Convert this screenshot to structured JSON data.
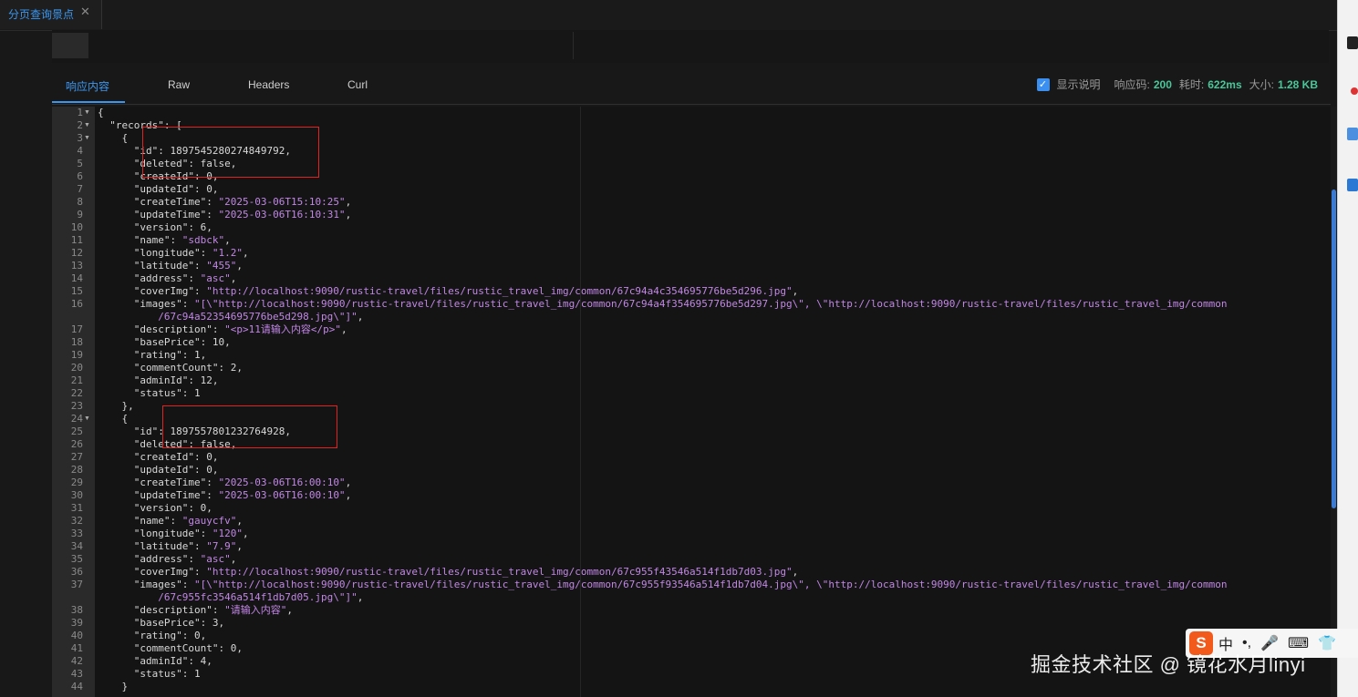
{
  "tab": {
    "title": "分页查询景点",
    "close": "✕"
  },
  "response_tabs": [
    "响应内容",
    "Raw",
    "Headers",
    "Curl"
  ],
  "meta": {
    "show_desc": "显示说明",
    "status_label": "响应码:",
    "status_value": "200",
    "time_label": "耗时:",
    "time_value": "622ms",
    "size_label": "大小:",
    "size_value": "1.28 KB"
  },
  "code_lines": [
    [
      [
        "p",
        "{"
      ]
    ],
    [
      [
        "p",
        "  "
      ],
      [
        "k",
        "\"records\""
      ],
      [
        "p",
        ": ["
      ]
    ],
    [
      [
        "p",
        "    {"
      ]
    ],
    [
      [
        "p",
        "      "
      ],
      [
        "k",
        "\"id\""
      ],
      [
        "p",
        ": 1897545280274849792,"
      ]
    ],
    [
      [
        "p",
        "      "
      ],
      [
        "k",
        "\"deleted\""
      ],
      [
        "p",
        ": false,"
      ]
    ],
    [
      [
        "p",
        "      "
      ],
      [
        "k",
        "\"createId\""
      ],
      [
        "p",
        ": 0,"
      ]
    ],
    [
      [
        "p",
        "      "
      ],
      [
        "k",
        "\"updateId\""
      ],
      [
        "p",
        ": 0,"
      ]
    ],
    [
      [
        "p",
        "      "
      ],
      [
        "k",
        "\"createTime\""
      ],
      [
        "p",
        ": "
      ],
      [
        "s",
        "\"2025-03-06T15:10:25\""
      ],
      [
        "p",
        ","
      ]
    ],
    [
      [
        "p",
        "      "
      ],
      [
        "k",
        "\"updateTime\""
      ],
      [
        "p",
        ": "
      ],
      [
        "s",
        "\"2025-03-06T16:10:31\""
      ],
      [
        "p",
        ","
      ]
    ],
    [
      [
        "p",
        "      "
      ],
      [
        "k",
        "\"version\""
      ],
      [
        "p",
        ": 6,"
      ]
    ],
    [
      [
        "p",
        "      "
      ],
      [
        "k",
        "\"name\""
      ],
      [
        "p",
        ": "
      ],
      [
        "s",
        "\"sdbck\""
      ],
      [
        "p",
        ","
      ]
    ],
    [
      [
        "p",
        "      "
      ],
      [
        "k",
        "\"longitude\""
      ],
      [
        "p",
        ": "
      ],
      [
        "s",
        "\"1.2\""
      ],
      [
        "p",
        ","
      ]
    ],
    [
      [
        "p",
        "      "
      ],
      [
        "k",
        "\"latitude\""
      ],
      [
        "p",
        ": "
      ],
      [
        "s",
        "\"455\""
      ],
      [
        "p",
        ","
      ]
    ],
    [
      [
        "p",
        "      "
      ],
      [
        "k",
        "\"address\""
      ],
      [
        "p",
        ": "
      ],
      [
        "s",
        "\"asc\""
      ],
      [
        "p",
        ","
      ]
    ],
    [
      [
        "p",
        "      "
      ],
      [
        "k",
        "\"coverImg\""
      ],
      [
        "p",
        ": "
      ],
      [
        "s",
        "\"http://localhost:9090/rustic-travel/files/rustic_travel_img/common/67c94a4c354695776be5d296.jpg\""
      ],
      [
        "p",
        ","
      ]
    ],
    [
      [
        "p",
        "      "
      ],
      [
        "k",
        "\"images\""
      ],
      [
        "p",
        ": "
      ],
      [
        "s",
        "\"[\\\"http://localhost:9090/rustic-travel/files/rustic_travel_img/common/67c94a4f354695776be5d297.jpg\\\", \\\"http://localhost:9090/rustic-travel/files/rustic_travel_img/common"
      ]
    ],
    [
      [
        "s",
        "          /67c94a52354695776be5d298.jpg\\\"]\""
      ],
      [
        "p",
        ","
      ]
    ],
    [
      [
        "p",
        "      "
      ],
      [
        "k",
        "\"description\""
      ],
      [
        "p",
        ": "
      ],
      [
        "s",
        "\"<p>11请输入内容</p>\""
      ],
      [
        "p",
        ","
      ]
    ],
    [
      [
        "p",
        "      "
      ],
      [
        "k",
        "\"basePrice\""
      ],
      [
        "p",
        ": 10,"
      ]
    ],
    [
      [
        "p",
        "      "
      ],
      [
        "k",
        "\"rating\""
      ],
      [
        "p",
        ": 1,"
      ]
    ],
    [
      [
        "p",
        "      "
      ],
      [
        "k",
        "\"commentCount\""
      ],
      [
        "p",
        ": 2,"
      ]
    ],
    [
      [
        "p",
        "      "
      ],
      [
        "k",
        "\"adminId\""
      ],
      [
        "p",
        ": 12,"
      ]
    ],
    [
      [
        "p",
        "      "
      ],
      [
        "k",
        "\"status\""
      ],
      [
        "p",
        ": 1"
      ]
    ],
    [
      [
        "p",
        "    },"
      ]
    ],
    [
      [
        "p",
        "    {"
      ]
    ],
    [
      [
        "p",
        "      "
      ],
      [
        "k",
        "\"id\""
      ],
      [
        "p",
        ": 1897557801232764928,"
      ]
    ],
    [
      [
        "p",
        "      "
      ],
      [
        "k",
        "\"deleted\""
      ],
      [
        "p",
        ": false,"
      ]
    ],
    [
      [
        "p",
        "      "
      ],
      [
        "k",
        "\"createId\""
      ],
      [
        "p",
        ": 0,"
      ]
    ],
    [
      [
        "p",
        "      "
      ],
      [
        "k",
        "\"updateId\""
      ],
      [
        "p",
        ": 0,"
      ]
    ],
    [
      [
        "p",
        "      "
      ],
      [
        "k",
        "\"createTime\""
      ],
      [
        "p",
        ": "
      ],
      [
        "s",
        "\"2025-03-06T16:00:10\""
      ],
      [
        "p",
        ","
      ]
    ],
    [
      [
        "p",
        "      "
      ],
      [
        "k",
        "\"updateTime\""
      ],
      [
        "p",
        ": "
      ],
      [
        "s",
        "\"2025-03-06T16:00:10\""
      ],
      [
        "p",
        ","
      ]
    ],
    [
      [
        "p",
        "      "
      ],
      [
        "k",
        "\"version\""
      ],
      [
        "p",
        ": 0,"
      ]
    ],
    [
      [
        "p",
        "      "
      ],
      [
        "k",
        "\"name\""
      ],
      [
        "p",
        ": "
      ],
      [
        "s",
        "\"gauycfv\""
      ],
      [
        "p",
        ","
      ]
    ],
    [
      [
        "p",
        "      "
      ],
      [
        "k",
        "\"longitude\""
      ],
      [
        "p",
        ": "
      ],
      [
        "s",
        "\"120\""
      ],
      [
        "p",
        ","
      ]
    ],
    [
      [
        "p",
        "      "
      ],
      [
        "k",
        "\"latitude\""
      ],
      [
        "p",
        ": "
      ],
      [
        "s",
        "\"7.9\""
      ],
      [
        "p",
        ","
      ]
    ],
    [
      [
        "p",
        "      "
      ],
      [
        "k",
        "\"address\""
      ],
      [
        "p",
        ": "
      ],
      [
        "s",
        "\"asc\""
      ],
      [
        "p",
        ","
      ]
    ],
    [
      [
        "p",
        "      "
      ],
      [
        "k",
        "\"coverImg\""
      ],
      [
        "p",
        ": "
      ],
      [
        "s",
        "\"http://localhost:9090/rustic-travel/files/rustic_travel_img/common/67c955f43546a514f1db7d03.jpg\""
      ],
      [
        "p",
        ","
      ]
    ],
    [
      [
        "p",
        "      "
      ],
      [
        "k",
        "\"images\""
      ],
      [
        "p",
        ": "
      ],
      [
        "s",
        "\"[\\\"http://localhost:9090/rustic-travel/files/rustic_travel_img/common/67c955f93546a514f1db7d04.jpg\\\", \\\"http://localhost:9090/rustic-travel/files/rustic_travel_img/common"
      ]
    ],
    [
      [
        "s",
        "          /67c955fc3546a514f1db7d05.jpg\\\"]\""
      ],
      [
        "p",
        ","
      ]
    ],
    [
      [
        "p",
        "      "
      ],
      [
        "k",
        "\"description\""
      ],
      [
        "p",
        ": "
      ],
      [
        "s",
        "\"请输入内容\""
      ],
      [
        "p",
        ","
      ]
    ],
    [
      [
        "p",
        "      "
      ],
      [
        "k",
        "\"basePrice\""
      ],
      [
        "p",
        ": 3,"
      ]
    ],
    [
      [
        "p",
        "      "
      ],
      [
        "k",
        "\"rating\""
      ],
      [
        "p",
        ": 0,"
      ]
    ],
    [
      [
        "p",
        "      "
      ],
      [
        "k",
        "\"commentCount\""
      ],
      [
        "p",
        ": 0,"
      ]
    ],
    [
      [
        "p",
        "      "
      ],
      [
        "k",
        "\"adminId\""
      ],
      [
        "p",
        ": 4,"
      ]
    ],
    [
      [
        "p",
        "      "
      ],
      [
        "k",
        "\"status\""
      ],
      [
        "p",
        ": 1"
      ]
    ],
    [
      [
        "p",
        "    }"
      ]
    ]
  ],
  "line_numbers": [
    "1",
    "2",
    "3",
    "4",
    "5",
    "6",
    "7",
    "8",
    "9",
    "10",
    "11",
    "12",
    "13",
    "14",
    "15",
    "16",
    "",
    "17",
    "18",
    "19",
    "20",
    "21",
    "22",
    "23",
    "24",
    "25",
    "26",
    "27",
    "28",
    "29",
    "30",
    "31",
    "32",
    "33",
    "34",
    "35",
    "36",
    "37",
    "",
    "38",
    "39",
    "40",
    "41",
    "42",
    "43",
    "44"
  ],
  "folds": [
    "1",
    "2",
    "3",
    "24"
  ],
  "ime": {
    "logo": "S",
    "lang": "中",
    "punct": "•,",
    "mic": "🎤",
    "keyboard": "⌨",
    "shirt": "👕"
  },
  "watermark": "掘金技术社区 @ 镜花水月linyi"
}
